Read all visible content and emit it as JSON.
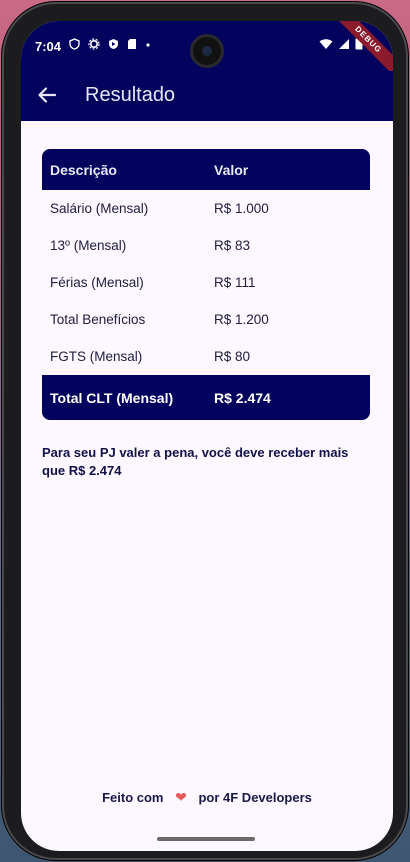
{
  "status_bar": {
    "time": "7:04",
    "debug_label": "DEBUG"
  },
  "app_bar": {
    "title": "Resultado"
  },
  "table": {
    "headers": [
      "Descrição",
      "Valor"
    ],
    "rows": [
      {
        "label": "Salário (Mensal)",
        "value": "R$ 1.000"
      },
      {
        "label": "13º (Mensal)",
        "value": "R$ 83"
      },
      {
        "label": "Férias (Mensal)",
        "value": "R$ 111"
      },
      {
        "label": "Total Benefícios",
        "value": "R$ 1.200"
      },
      {
        "label": "FGTS (Mensal)",
        "value": "R$ 80"
      }
    ],
    "total": {
      "label": "Total CLT (Mensal)",
      "value": "R$ 2.474"
    }
  },
  "note": "Para seu PJ valer a pena, você deve receber mais que R$ 2.474",
  "footer": {
    "prefix": "Feito com",
    "heart": "❤",
    "suffix": "por 4F Developers"
  },
  "colors": {
    "primary": "#03035e",
    "background": "#fdf7ff",
    "heart": "#e65a5a"
  }
}
